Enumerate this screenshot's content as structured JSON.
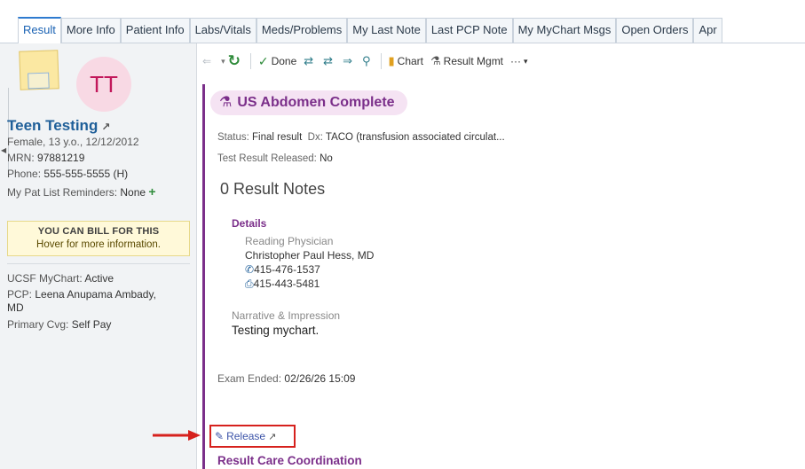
{
  "tabs": [
    "Result",
    "More Info",
    "Patient Info",
    "Labs/Vitals",
    "Meds/Problems",
    "My Last Note",
    "Last PCP Note",
    "My MyChart Msgs",
    "Open Orders",
    "Apr"
  ],
  "patient": {
    "initials": "TT",
    "name": "Teen Testing",
    "demographics": "Female, 13 y.o., 12/12/2012",
    "mrn_label": "MRN:",
    "mrn": "97881219",
    "phone_label": "Phone:",
    "phone": "555-555-5555 (H)",
    "reminders_label": "My Pat List Reminders:",
    "reminders": "None",
    "bill_line1": "YOU CAN BILL FOR THIS",
    "bill_line2": "Hover for more information.",
    "mychart_label": "UCSF MyChart:",
    "mychart": "Active",
    "pcp_label": "PCP:",
    "pcp": "Leena Anupama Ambady,",
    "pcp_cont": "MD",
    "cvg_label": "Primary Cvg:",
    "cvg": "Self Pay"
  },
  "toolbar": {
    "done": "Done",
    "chart": "Chart",
    "result_mgmt": "Result Mgmt",
    "more": "···"
  },
  "result": {
    "title": "US Abdomen Complete",
    "status_label": "Status:",
    "status": "Final result",
    "dx_label": "Dx:",
    "dx": "TACO (transfusion associated circulat...",
    "released_label": "Test Result Released:",
    "released": "No",
    "notes_count": "0",
    "notes_label": "Result Notes",
    "details_label": "Details",
    "reading_physician_label": "Reading Physician",
    "reading_physician": "Christopher Paul Hess, MD",
    "phone": "415-476-1537",
    "fax": "415-443-5481",
    "narrative_label": "Narrative & Impression",
    "narrative": "Testing mychart.",
    "exam_ended_label": "Exam Ended:",
    "exam_ended": "02/26/26 15:09",
    "release_label": "Release",
    "care_coordination": "Result Care Coordination"
  },
  "colors": {
    "accent_purple": "#7b2f8a",
    "highlight_red": "#d6211d",
    "link_blue": "#1f5f99"
  }
}
